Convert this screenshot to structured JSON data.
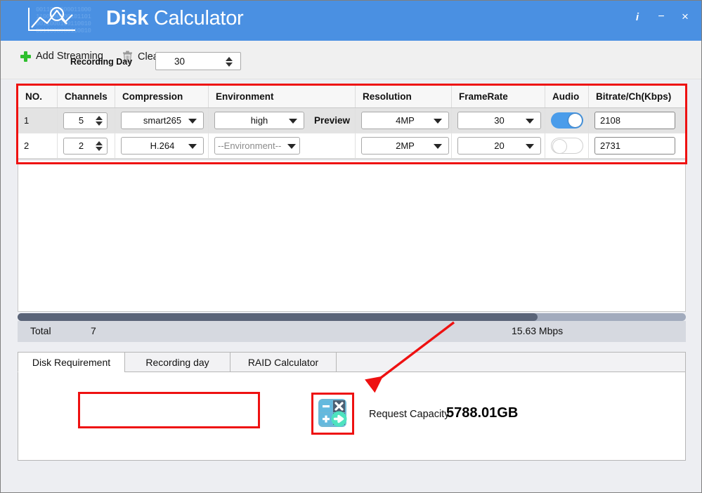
{
  "window": {
    "title_bold": "Disk",
    "title_light": " Calculator",
    "logo_icon": "chart-magnifier-icon",
    "logo_binary": "0011001000011000\n1100100000101101\n0011000100110010\n0011000000110010",
    "controls": [
      {
        "name": "info-button",
        "glyph": "i"
      },
      {
        "name": "minimize-button",
        "glyph": "−"
      },
      {
        "name": "close-button",
        "glyph": "×"
      }
    ]
  },
  "toolbar": {
    "add_streaming_label": "Add Streaming",
    "add_streaming_icon": "plus-icon",
    "clear_all_label": "Clear All",
    "clear_all_icon": "trash-icon"
  },
  "grid": {
    "columns": [
      "NO.",
      "Channels",
      "Compression",
      "Environment",
      "Resolution",
      "FrameRate",
      "Audio",
      "Bitrate/Ch(Kbps)"
    ],
    "rows": [
      {
        "no": "1",
        "channels": "5",
        "compression": "smart265",
        "environment": "high",
        "environment_is_placeholder": false,
        "preview_label": "Preview",
        "resolution": "4MP",
        "framerate": "30",
        "audio_on": true,
        "bitrate": "2108"
      },
      {
        "no": "2",
        "channels": "2",
        "compression": "H.264",
        "environment": "--Environment--",
        "environment_is_placeholder": true,
        "preview_label": "",
        "resolution": "2MP",
        "framerate": "20",
        "audio_on": false,
        "bitrate": "2731"
      }
    ]
  },
  "total": {
    "label": "Total",
    "count": "7",
    "bandwidth": "15.63 Mbps"
  },
  "tabs": [
    {
      "label": "Disk Requirement",
      "active": true
    },
    {
      "label": "Recording day",
      "active": false
    },
    {
      "label": "RAID Calculator",
      "active": false
    }
  ],
  "disk_requirement": {
    "recording_day_label": "Recording Day",
    "recording_day_value": "30",
    "calculate_icon": "calculator-icon",
    "request_capacity_label": "Request Capacity:",
    "request_capacity_value": "5788.01GB"
  },
  "colors": {
    "title_bar": "#4a90e2",
    "accent_toggle": "#4a9cea",
    "annotation": "#ee1111",
    "scrollbar_thumb": "#5a6478",
    "scrollbar_track": "#a2abbd",
    "total_bar": "#d6d9e0",
    "add_icon_green": "#2fbf2f",
    "calc_icon_teal": "#4ee3bf"
  }
}
